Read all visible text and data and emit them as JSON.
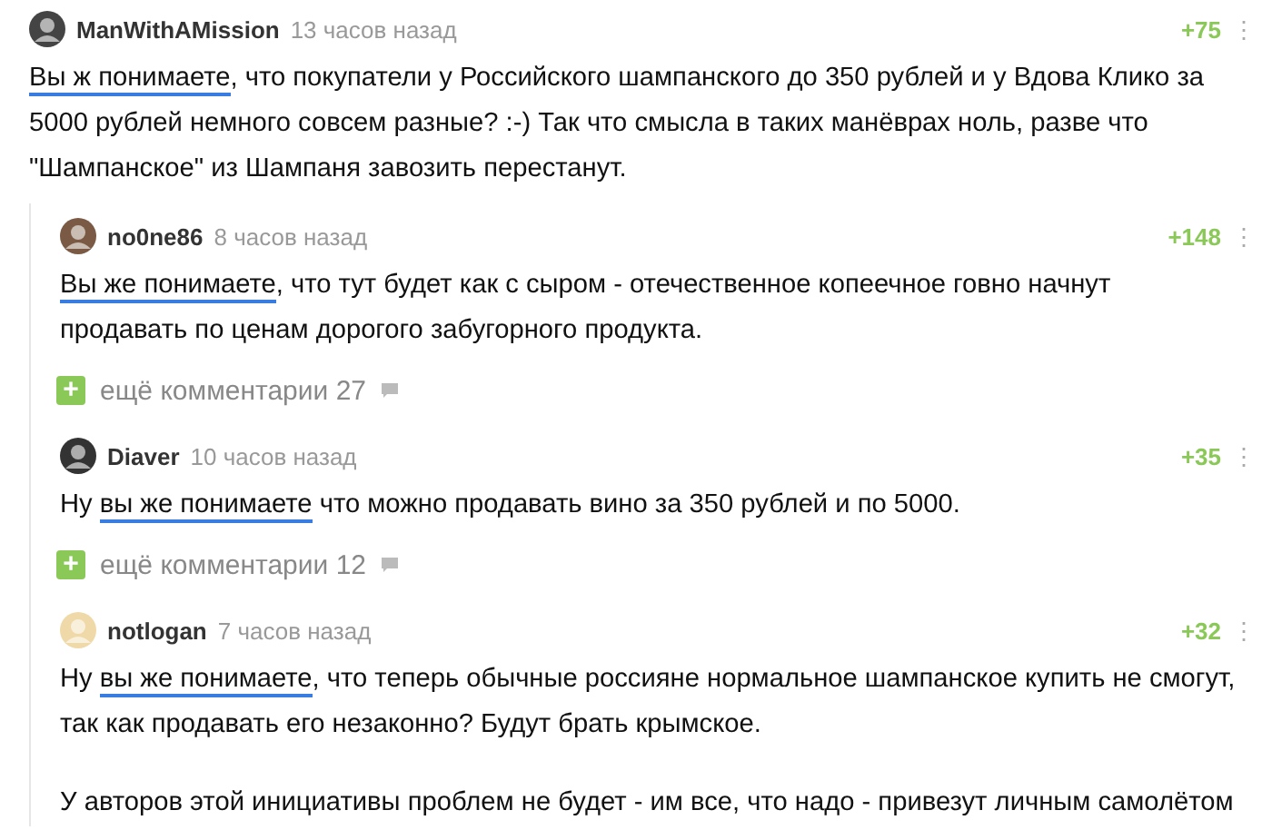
{
  "comment": {
    "author": "ManWithAMission",
    "time": "13 часов назад",
    "rating": "+75",
    "menu": "⋮",
    "paragraphs": [
      [
        {
          "text": "Вы ж понимаете",
          "underlined": true
        },
        {
          "text": ", что покупатели у Российского шампанского до 350 рублей и у Вдова Клико за\n5000 рублей немного совсем разные? :-) Так что смысла в таких манёврах ноль, разве что\n\"Шампанское\" из Шампаня завозить перестанут.",
          "underlined": false
        }
      ]
    ],
    "replies": [
      {
        "kind": "comment",
        "author": "no0ne86",
        "time": "8 часов назад",
        "rating": "+148",
        "menu": "⋮",
        "paragraphs": [
          [
            {
              "text": "Вы же понимаете",
              "underlined": true
            },
            {
              "text": ", что тут будет как с сыром - отечественное копеечное говно начнут\nпродавать по ценам дорогого забугорного продукта.",
              "underlined": false
            }
          ]
        ]
      },
      {
        "kind": "more",
        "plus": "+",
        "label": "ещё комментарии 27"
      },
      {
        "kind": "comment",
        "author": "Diaver",
        "time": "10 часов назад",
        "rating": "+35",
        "menu": "⋮",
        "paragraphs": [
          [
            {
              "text": "Ну ",
              "underlined": false
            },
            {
              "text": "вы же понимаете",
              "underlined": true
            },
            {
              "text": " что можно продавать вино за 350 рублей и по 5000.",
              "underlined": false
            }
          ]
        ]
      },
      {
        "kind": "more",
        "plus": "+",
        "label": "ещё комментарии 12"
      },
      {
        "kind": "comment",
        "author": "notlogan",
        "time": "7 часов назад",
        "rating": "+32",
        "menu": "⋮",
        "paragraphs": [
          [
            {
              "text": "Ну ",
              "underlined": false
            },
            {
              "text": "вы же понимаете",
              "underlined": true
            },
            {
              "text": ", что теперь обычные россияне нормальное шампанское купить не смогут,\nтак как продавать его незаконно? Будут брать крымское.",
              "underlined": false
            }
          ],
          [
            {
              "text": "У авторов этой инициативы проблем не будет - им все, что надо - привезут личным самолётом",
              "underlined": false
            }
          ]
        ]
      }
    ]
  }
}
